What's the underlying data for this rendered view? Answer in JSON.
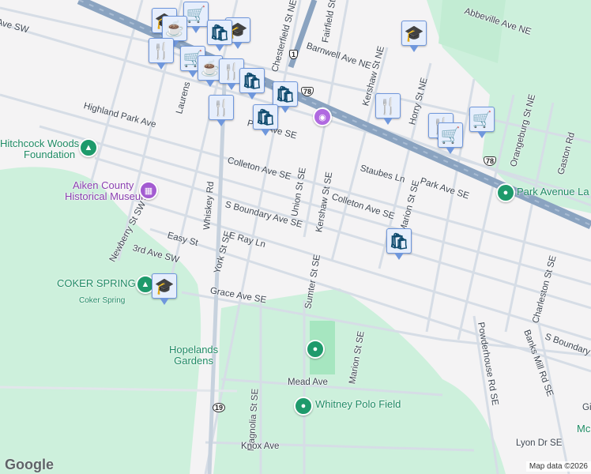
{
  "streets": [
    "Ave SW",
    "Chesterfield St NE",
    "Fairfield St NE",
    "Abbeville Ave NE",
    "Barnwell Ave NE",
    "Kershaw St NE",
    "Horry St NE",
    "Highland Park Ave",
    "Laurens",
    "Park Ave SE",
    "Colleton Ave SE",
    "Union St SE",
    "Kershaw St SE",
    "Staubes Ln",
    "Park Ave SE",
    "Colleton Ave SE",
    "S Boundary Ave SE",
    "Marion St SE",
    "Whiskey Rd",
    "Newberry St SW",
    "Easy St",
    "3rd Ave SW",
    "York St SE",
    "E Ray Ln",
    "Sumter St SE",
    "Powderhouse Rd SE",
    "Charleston St SE",
    "S Boundary A",
    "Banks Mill Rd SE",
    "Grace Ave SE",
    "Marion St SE",
    "Mead Ave",
    "Magnolia St SE",
    "Knox Ave",
    "Lyon Dr SE",
    "Gi",
    "Orangeburg St NE",
    "Gaston Rd"
  ],
  "places": {
    "hitchcock": "Hitchcock Woods",
    "hitchcock2": "Foundation",
    "museum1": "Aiken County",
    "museum2": "Historical Museum",
    "park_ave": "Park Avenue La",
    "coker": "COKER SPRING",
    "coker_small": "Coker Spring",
    "hopelands1": "Hopelands",
    "hopelands2": "Gardens",
    "polo": "Whitney Polo Field",
    "mcgh": "McGh"
  },
  "shields": [
    "1",
    "78",
    "78",
    "19"
  ],
  "marker_icons": {
    "restaurant": "🍴",
    "shopping": "🛍",
    "grocery": "🛒",
    "school": "🎓",
    "cafe": "☕"
  },
  "attribution": {
    "logo": "Google",
    "text": "Map data ©2026"
  }
}
